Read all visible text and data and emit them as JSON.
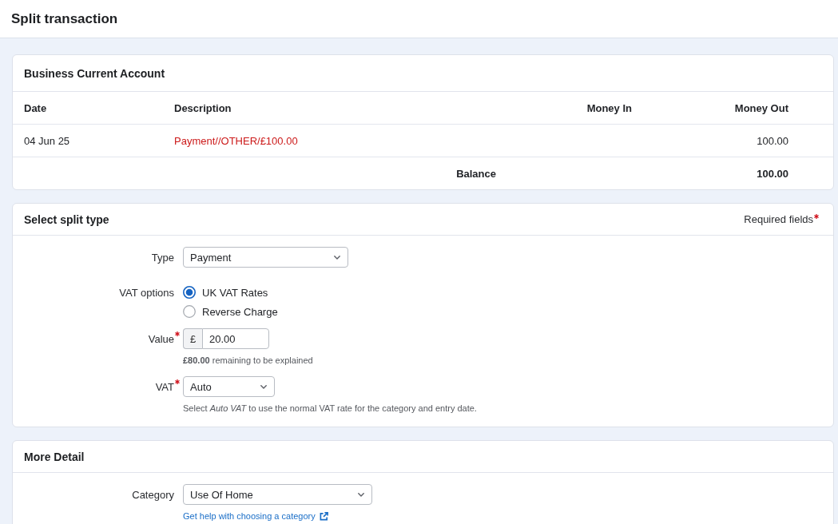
{
  "page": {
    "title": "Split transaction"
  },
  "account": {
    "title": "Business Current Account",
    "columns": [
      "Date",
      "Description",
      "Money In",
      "Money Out"
    ],
    "rows": [
      {
        "date": "04 Jun 25",
        "description": "Payment//OTHER/£100.00",
        "money_out": "100.00"
      }
    ],
    "balance": {
      "label": "Balance",
      "money_out": "100.00"
    }
  },
  "split_type": {
    "title": "Select split type",
    "required_note": "Required fields",
    "fields": [
      {
        "kind": "select",
        "label": "Type",
        "required": false,
        "value": "Payment"
      },
      {
        "kind": "radio",
        "label": "VAT options",
        "required": false,
        "options": [
          {
            "label": "UK VAT Rates",
            "selected": true
          },
          {
            "label": "Reverse Charge",
            "selected": false
          }
        ]
      },
      {
        "kind": "money",
        "label": "Value",
        "required": true,
        "prefix": "£",
        "value": "20.00",
        "help": "**£80.00** remaining to be explained"
      },
      {
        "kind": "select",
        "label": "VAT",
        "required": true,
        "value": "Auto",
        "help": "Select *Auto VAT* to use the normal VAT rate for the category and entry date."
      }
    ]
  },
  "more_detail": {
    "title": "More Detail",
    "fields": [
      {
        "kind": "select",
        "label": "Category",
        "required": false,
        "value": "Use Of Home",
        "link": "Get help with choosing a category"
      }
    ]
  }
}
